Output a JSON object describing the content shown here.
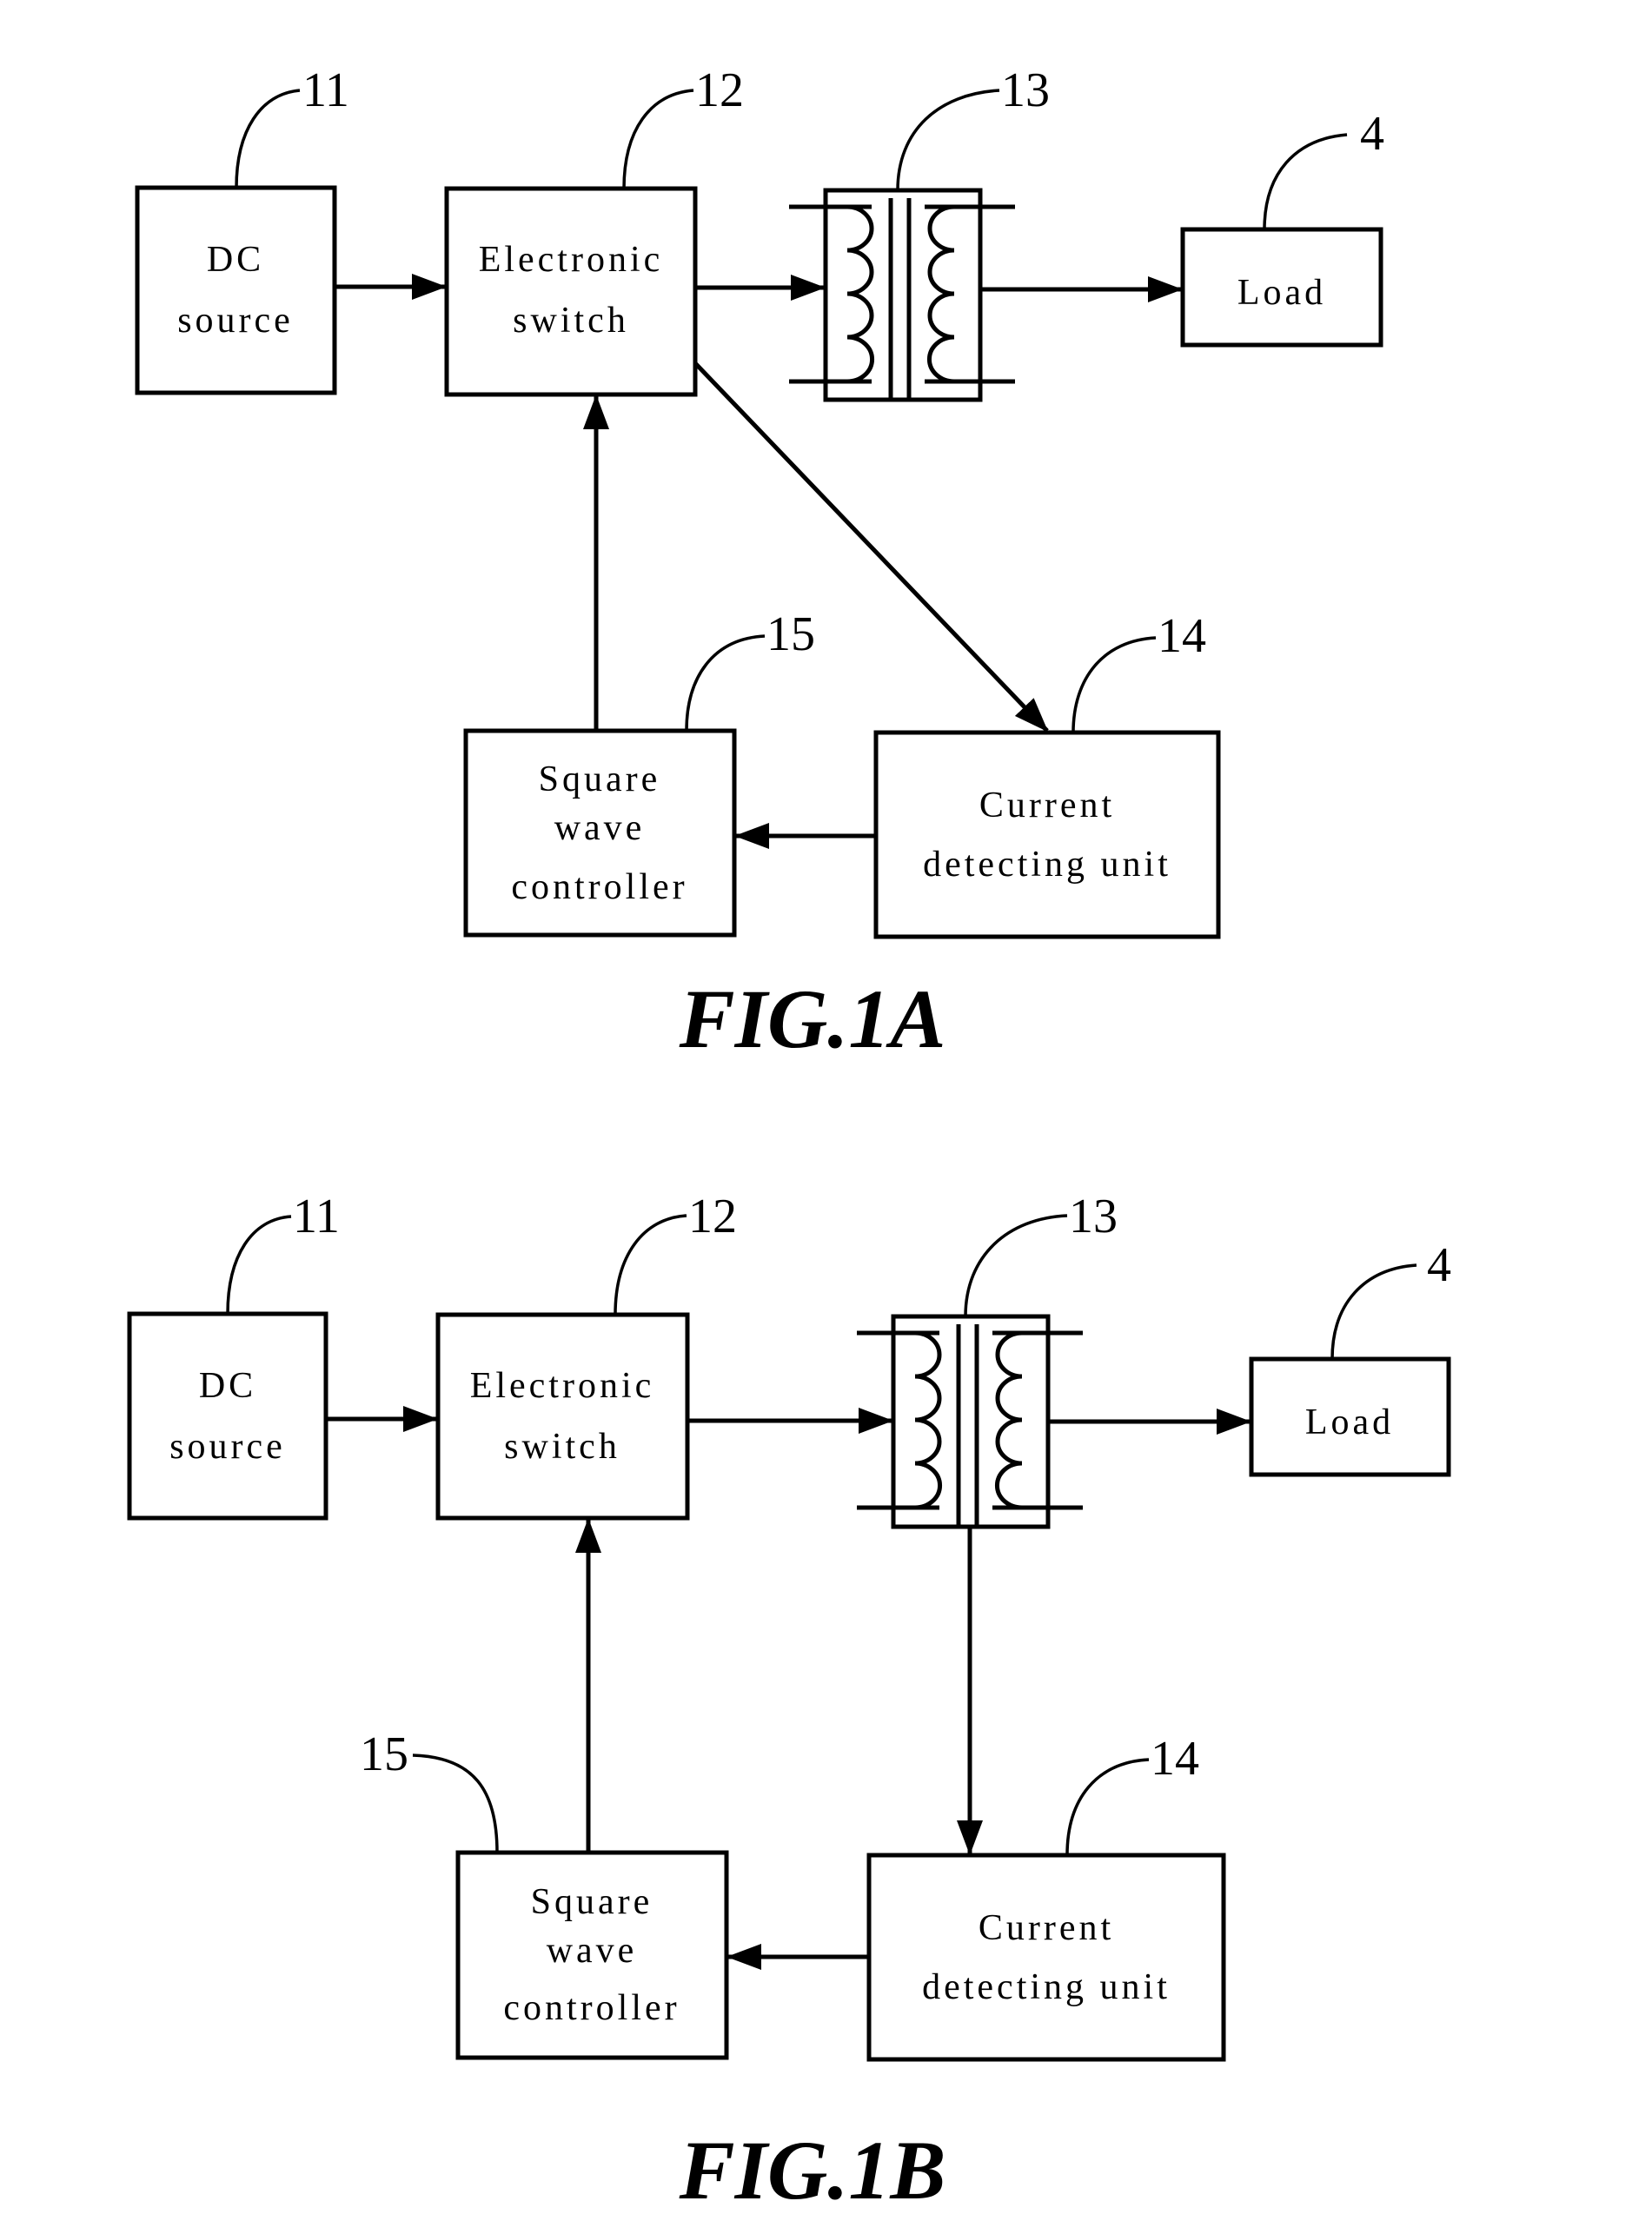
{
  "figures": {
    "fig1a": {
      "caption": "FIG.1A",
      "blocks": {
        "dc_source": {
          "ref": "11",
          "line1": "DC",
          "line2": "source"
        },
        "electronic_switch": {
          "ref": "12",
          "line1": "Electronic",
          "line2": "switch"
        },
        "transformer": {
          "ref": "13"
        },
        "load": {
          "ref": "4",
          "line1": "Load"
        },
        "square_wave_controller": {
          "ref": "15",
          "line1": "Square",
          "line2": "wave",
          "line3": "controller"
        },
        "current_detecting_unit": {
          "ref": "14",
          "line1": "Current",
          "line2": "detecting unit"
        }
      }
    },
    "fig1b": {
      "caption": "FIG.1B",
      "blocks": {
        "dc_source": {
          "ref": "11",
          "line1": "DC",
          "line2": "source"
        },
        "electronic_switch": {
          "ref": "12",
          "line1": "Electronic",
          "line2": "switch"
        },
        "transformer": {
          "ref": "13"
        },
        "load": {
          "ref": "4",
          "line1": "Load"
        },
        "square_wave_controller": {
          "ref": "15",
          "line1": "Square",
          "line2": "wave",
          "line3": "controller"
        },
        "current_detecting_unit": {
          "ref": "14",
          "line1": "Current",
          "line2": "detecting unit"
        }
      }
    }
  }
}
